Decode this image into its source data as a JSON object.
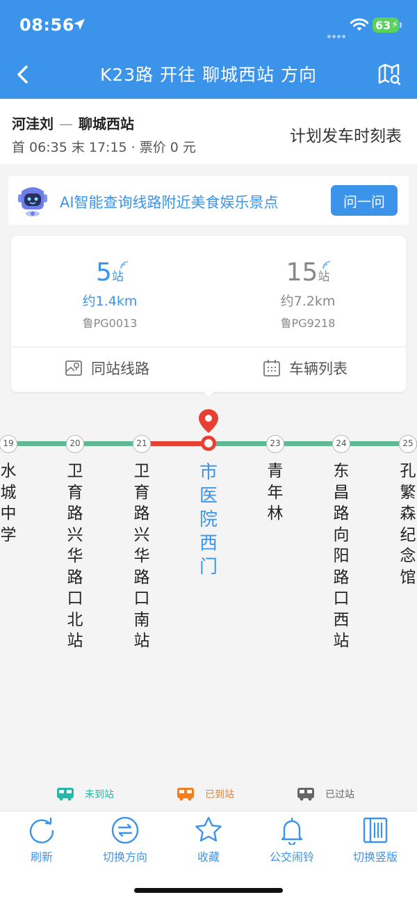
{
  "status_bar": {
    "time": "08:56",
    "battery": "63"
  },
  "header": {
    "title": "K23路 开往 聊城西站 方向"
  },
  "route": {
    "from": "河洼刘",
    "separator": "—",
    "to": "聊城西站",
    "times": "首 06:35 末 17:15 · 票价 0 元",
    "schedule_label": "计划发车时刻表"
  },
  "ai_banner": {
    "text": "AI智能查询线路附近美食娱乐景点",
    "button": "问一问"
  },
  "buses": [
    {
      "stops": "5",
      "unit": "站",
      "distance": "约1.4km",
      "plate": "鲁PG0013"
    },
    {
      "stops": "15",
      "unit": "站",
      "distance": "约7.2km",
      "plate": "鲁PG9218"
    }
  ],
  "card_actions": {
    "same_station": "同站线路",
    "vehicle_list": "车辆列表"
  },
  "stops": [
    {
      "num": "19",
      "name": "水城中学"
    },
    {
      "num": "20",
      "name": "卫育路兴华路口北站"
    },
    {
      "num": "21",
      "name": "卫育路兴华路口南站"
    },
    {
      "num": "",
      "name": "市医院西门"
    },
    {
      "num": "23",
      "name": "青年林"
    },
    {
      "num": "24",
      "name": "东昌路向阳路口西站"
    },
    {
      "num": "25",
      "name": "孔繁森纪念馆"
    }
  ],
  "legend": {
    "not_arrived": "未到站",
    "arrived": "已到站",
    "passed": "已过站"
  },
  "tabs": {
    "refresh": "刷新",
    "switch_direction": "切换方向",
    "favorite": "收藏",
    "alarm": "公交闹铃",
    "vertical": "切换竖版"
  },
  "colors": {
    "accent": "#3b94ea",
    "line_green": "#5fb994",
    "line_red": "#e74033",
    "arrived_orange": "#f07f21",
    "passed_gray": "#666666",
    "not_arrived_teal": "#29b5a8"
  }
}
